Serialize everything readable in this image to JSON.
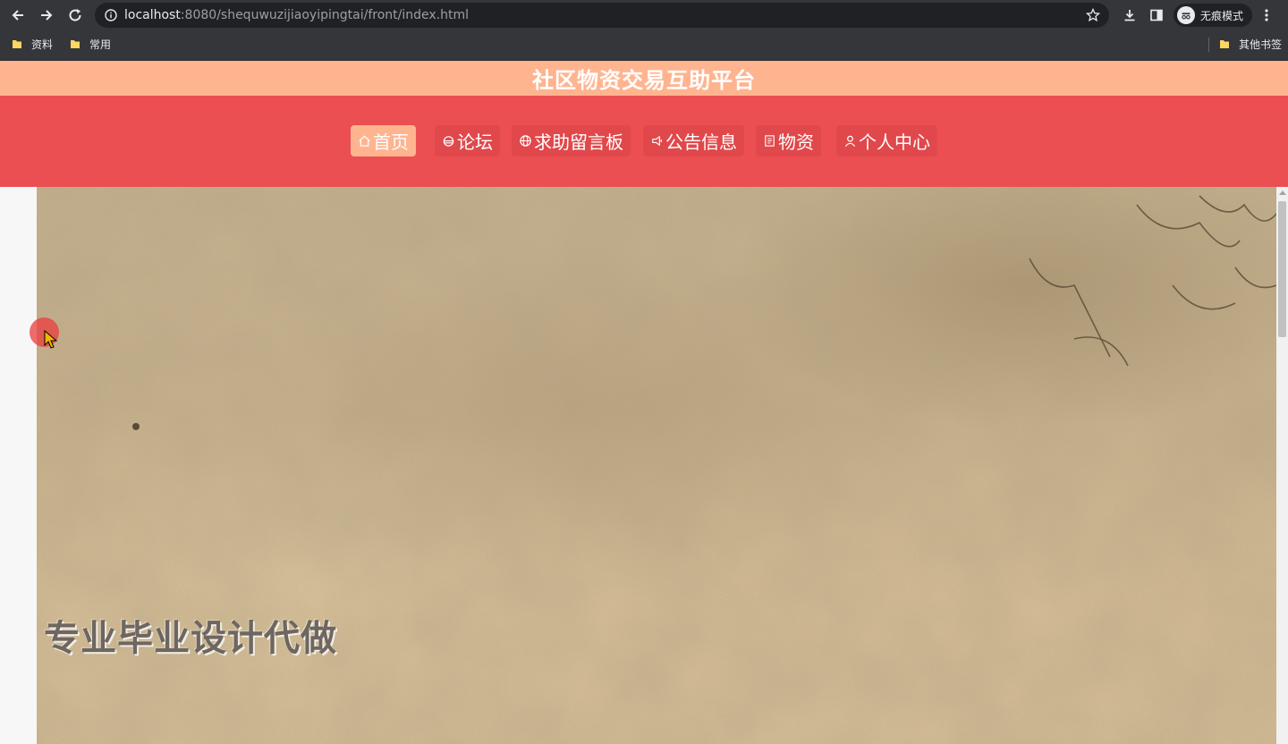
{
  "browser": {
    "url_host": "localhost",
    "url_rest": ":8080/shequwuzijiaoyipingtai/front/index.html",
    "incognito_label": "无痕模式",
    "bookmarks": [
      {
        "label": "资料"
      },
      {
        "label": "常用"
      },
      {
        "label": "其他书签"
      }
    ]
  },
  "page": {
    "title": "社区物资交易互助平台",
    "nav": [
      {
        "label": "首页",
        "icon": "home-icon",
        "active": true
      },
      {
        "label": "论坛",
        "icon": "forum-icon",
        "active": false
      },
      {
        "label": "求助留言板",
        "icon": "globe-icon",
        "active": false
      },
      {
        "label": "公告信息",
        "icon": "announcement-icon",
        "active": false
      },
      {
        "label": "物资",
        "icon": "document-icon",
        "active": false
      },
      {
        "label": "个人中心",
        "icon": "user-icon",
        "active": false
      }
    ],
    "hero_caption": "专业毕业设计代做"
  },
  "colors": {
    "title_bar": "#ffb490",
    "nav_bar": "#eb4f52",
    "active_nav": "#ffb490",
    "browser_chrome": "#35363a"
  }
}
